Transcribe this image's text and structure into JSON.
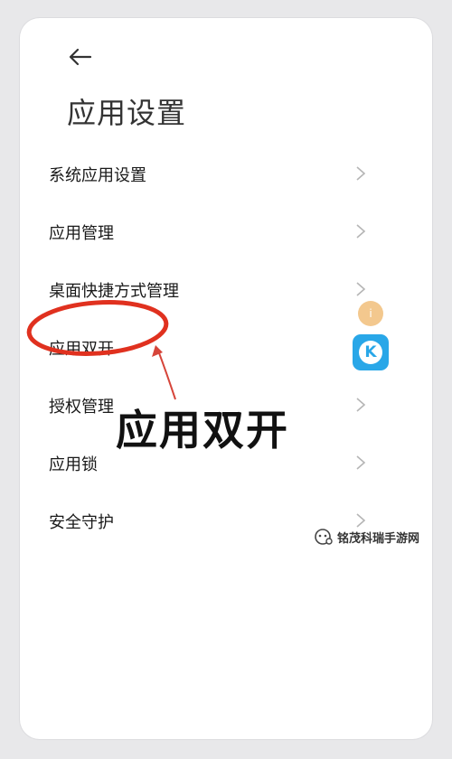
{
  "header": {
    "back_icon": "arrow-left-icon",
    "title": "应用设置"
  },
  "menu": {
    "items": [
      {
        "label": "系统应用设置",
        "icon": "chevron-right-icon"
      },
      {
        "label": "应用管理",
        "icon": "chevron-right-icon"
      },
      {
        "label": "桌面快捷方式管理",
        "icon": "chevron-right-icon"
      },
      {
        "label": "应用双开",
        "icon": "chevron-right-icon"
      },
      {
        "label": "授权管理",
        "icon": "chevron-right-icon"
      },
      {
        "label": "应用锁",
        "icon": "chevron-right-icon"
      },
      {
        "label": "安全守护",
        "icon": "chevron-right-icon"
      }
    ]
  },
  "annotation": {
    "callout": "应用双开",
    "highlight_color": "#e0311f"
  },
  "floating": {
    "badge_a": "i",
    "badge_k": "K"
  },
  "watermark": {
    "text": "铭茂科瑞手游网"
  }
}
